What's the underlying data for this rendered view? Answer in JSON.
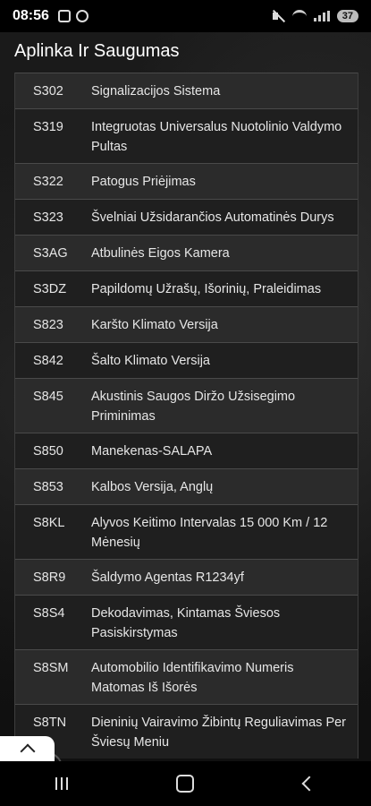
{
  "status_bar": {
    "time": "08:56",
    "battery": "37"
  },
  "page": {
    "title": "Aplinka Ir Saugumas"
  },
  "items": [
    {
      "code": "S302",
      "label": "Signalizacijos Sistema"
    },
    {
      "code": "S319",
      "label": "Integruotas Universalus Nuotolinio Valdymo Pultas"
    },
    {
      "code": "S322",
      "label": "Patogus Priėjimas"
    },
    {
      "code": "S323",
      "label": "Švelniai Užsidarančios Automatinės Durys"
    },
    {
      "code": "S3AG",
      "label": "Atbulinės Eigos Kamera"
    },
    {
      "code": "S3DZ",
      "label": "Papildomų Užrašų, Išorinių, Praleidimas"
    },
    {
      "code": "S823",
      "label": "Karšto Klimato Versija"
    },
    {
      "code": "S842",
      "label": "Šalto Klimato Versija"
    },
    {
      "code": "S845",
      "label": "Akustinis Saugos Diržo Užsisegimo Priminimas"
    },
    {
      "code": "S850",
      "label": "Manekenas-SALAPA"
    },
    {
      "code": "S853",
      "label": "Kalbos Versija, Anglų"
    },
    {
      "code": "S8KL",
      "label": "Alyvos Keitimo Intervalas 15 000 Km / 12 Mėnesių"
    },
    {
      "code": "S8R9",
      "label": "Šaldymo Agentas R1234yf"
    },
    {
      "code": "S8S4",
      "label": "Dekodavimas, Kintamas Šviesos Pasiskirstymas"
    },
    {
      "code": "S8SM",
      "label": "Automobilio Identifikavimo Numeris Matomas Iš Išorės"
    },
    {
      "code": "S8TN",
      "label": "Dieninių Vairavimo Žibintų Reguliavimas Per Šviesų Meniu"
    }
  ]
}
